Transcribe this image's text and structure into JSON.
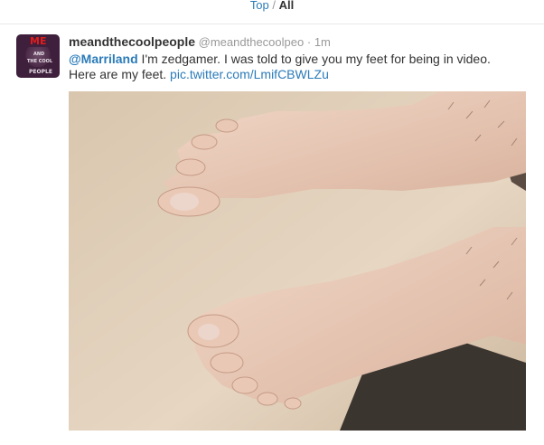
{
  "filter": {
    "top_label": "Top",
    "separator": "/",
    "all_label": "All"
  },
  "tweet": {
    "avatar": {
      "line1": "ME",
      "line2": "AND",
      "line3": "THE COOL",
      "line4": "PEOPLE"
    },
    "fullname": "meandthecoolpeople",
    "username": "@meandthecoolpeo",
    "separator": "·",
    "time": "1m",
    "mention": "@Marriland",
    "text_part1": " I'm zedgamer. I was told to give you my feet for being in video. Here are my feet. ",
    "link": "pic.twitter.com/LmifCBWLZu"
  },
  "colors": {
    "link": "#2b7bb9",
    "text": "#333333",
    "muted": "#999999"
  }
}
